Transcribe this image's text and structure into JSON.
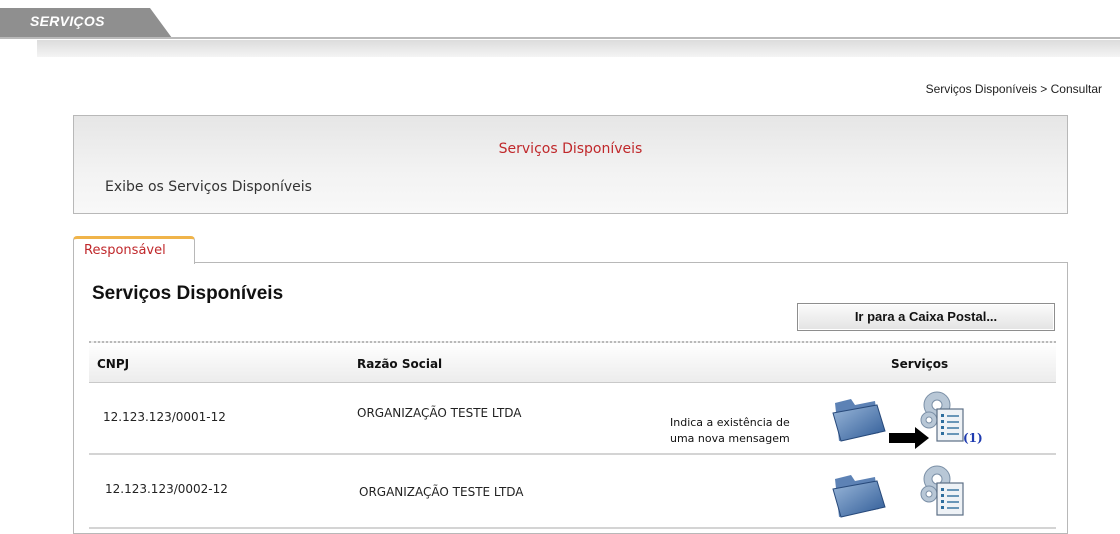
{
  "topbar": {
    "tab_label": "SERVIÇOS"
  },
  "breadcrumb": "Serviços Disponíveis > Consultar",
  "header": {
    "title": "Serviços Disponíveis",
    "description": "Exibe os Serviços Disponíveis"
  },
  "tabs": [
    {
      "label": "Responsável",
      "active": true
    }
  ],
  "section": {
    "title": "Serviços Disponíveis",
    "caixa_button": "Ir para a Caixa Postal..."
  },
  "table": {
    "columns": [
      "CNPJ",
      "Razão Social",
      "Serviços"
    ],
    "rows": [
      {
        "cnpj": "12.123.123/0001-12",
        "razao_social": "ORGANIZAÇÃO TESTE LTDA",
        "annotation": [
          "Indica a existência de",
          "uma nova mensagem"
        ],
        "message_count": "(1)",
        "icons": [
          "folder-icon",
          "settings-list-icon"
        ]
      },
      {
        "cnpj": "12.123.123/0002-12",
        "razao_social": "ORGANIZAÇÃO TESTE LTDA",
        "icons": [
          "folder-icon",
          "settings-list-icon"
        ]
      }
    ]
  },
  "colors": {
    "accent_red": "#c0282b",
    "tab_orange": "#f0b44a",
    "link_blue": "#1f3bb0",
    "tab_grey": "#8f8f8f"
  }
}
